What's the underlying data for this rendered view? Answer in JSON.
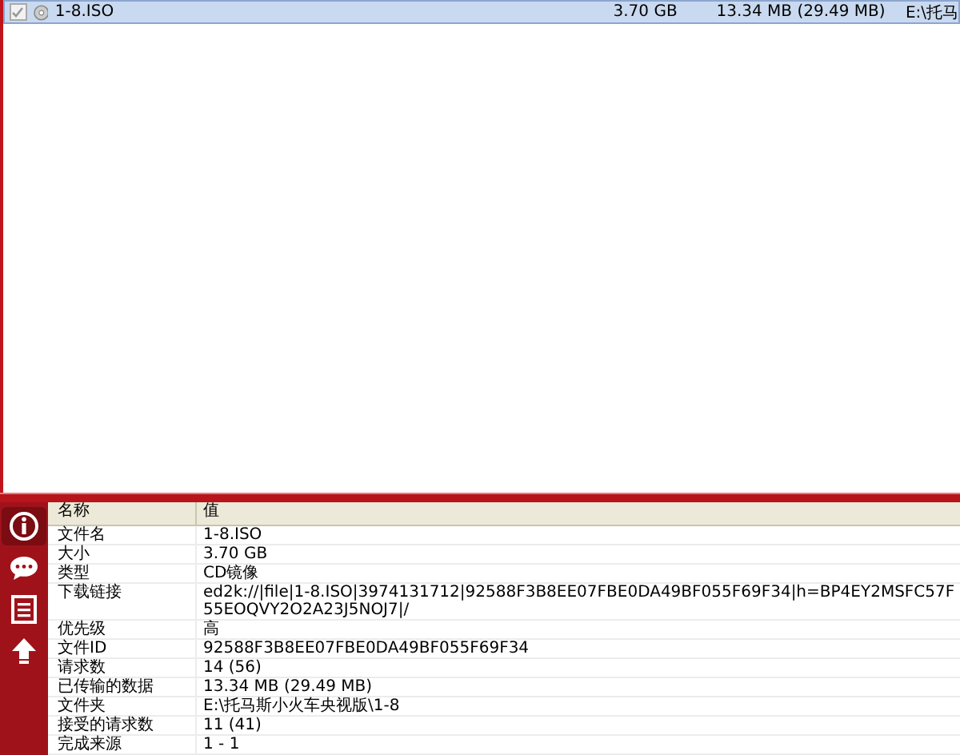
{
  "downloads": [
    {
      "name": "1-8.ISO",
      "size": "3.70 GB",
      "transferred": "13.34 MB (29.49 MB)",
      "folder": "E:\\托马",
      "checked": true,
      "selected": true
    }
  ],
  "sidebar": {
    "items": [
      {
        "kind": "info",
        "selected": true
      },
      {
        "kind": "chat",
        "selected": false
      },
      {
        "kind": "list",
        "selected": false
      },
      {
        "kind": "upload",
        "selected": false
      }
    ]
  },
  "details": {
    "columns": [
      "名称",
      "值"
    ],
    "rows": [
      {
        "name": "文件名",
        "value": "1-8.ISO"
      },
      {
        "name": "大小",
        "value": "3.70 GB"
      },
      {
        "name": "类型",
        "value": "CD镜像"
      },
      {
        "name": "下载链接",
        "value": "ed2k://|file|1-8.ISO|3974131712|92588F3B8EE07FBE0DA49BF055F69F34|h=BP4EY2MSFC57F55EOQVY2O2A23J5NOJ7|/"
      },
      {
        "name": "优先级",
        "value": "高"
      },
      {
        "name": "文件ID",
        "value": "92588F3B8EE07FBE0DA49BF055F69F34"
      },
      {
        "name": "请求数",
        "value": "14 (56)"
      },
      {
        "name": "已传输的数据",
        "value": "13.34 MB (29.49 MB)"
      },
      {
        "name": "文件夹",
        "value": "E:\\托马斯小火车央视版\\1-8"
      },
      {
        "name": "接受的请求数",
        "value": "11 (41)"
      },
      {
        "name": "完成来源",
        "value": "1 - 1"
      }
    ]
  }
}
